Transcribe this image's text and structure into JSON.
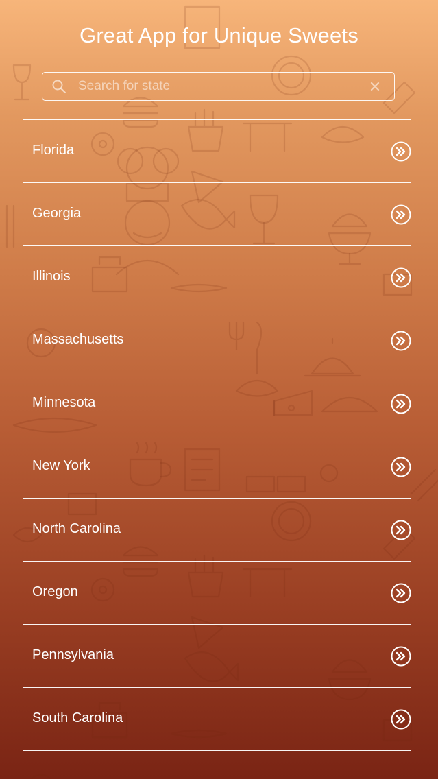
{
  "header": {
    "title": "Great App for Unique Sweets"
  },
  "search": {
    "placeholder": "Search for state",
    "value": "",
    "icon": "search-icon",
    "clear_icon": "close-icon"
  },
  "states": [
    {
      "name": "Florida"
    },
    {
      "name": "Georgia"
    },
    {
      "name": "Illinois"
    },
    {
      "name": "Massachusetts"
    },
    {
      "name": "Minnesota"
    },
    {
      "name": "New York"
    },
    {
      "name": "North Carolina"
    },
    {
      "name": "Oregon"
    },
    {
      "name": "Pennsylvania"
    },
    {
      "name": "South Carolina"
    }
  ],
  "row_icon": "double-chevron-right-icon",
  "colors": {
    "gradient_top": "#f7b57a",
    "gradient_bottom": "#7a2414",
    "text": "#ffffff"
  }
}
